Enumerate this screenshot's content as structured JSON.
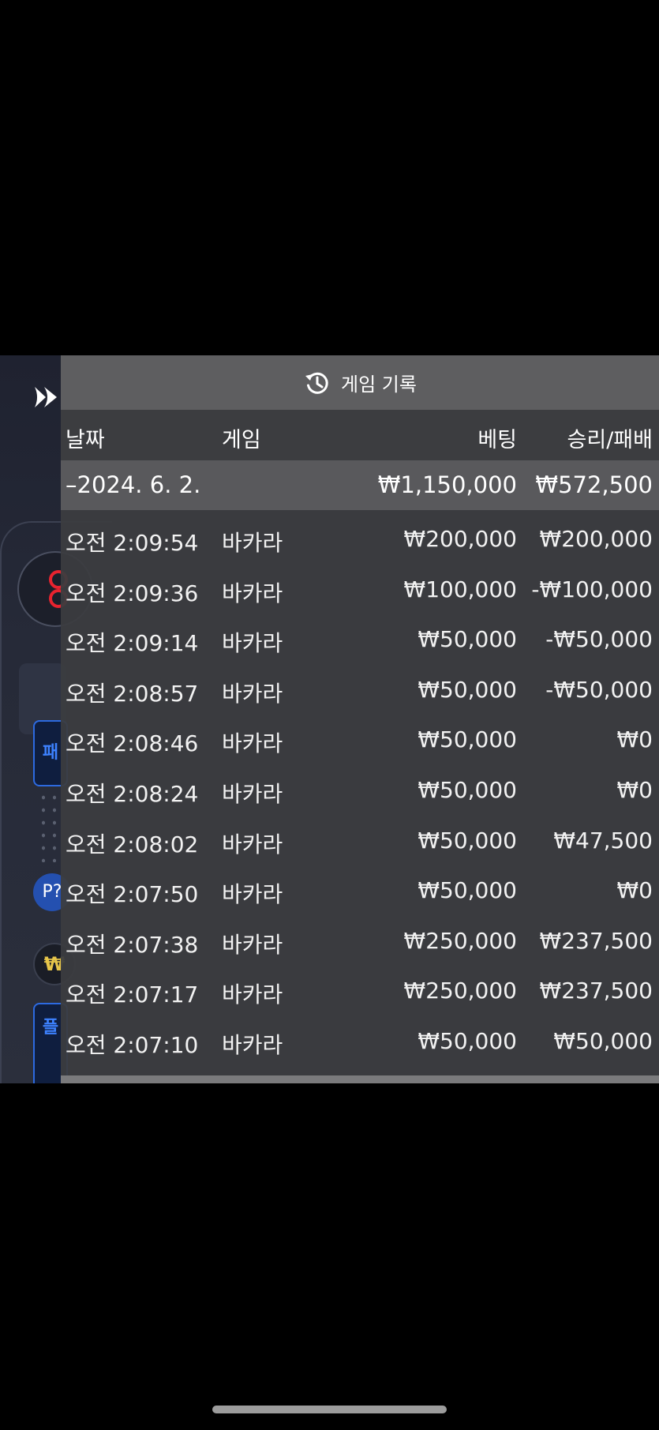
{
  "panel": {
    "title": "게임 기록",
    "title_icon": "history-icon"
  },
  "columns": {
    "date": "날짜",
    "game": "게임",
    "bet": "베팅",
    "win_loss": "승리/패배"
  },
  "summary": {
    "date": "–2024. 6. 2.",
    "bet": "₩1,150,000",
    "win_loss": "₩572,500"
  },
  "rows": [
    {
      "time": "오전 2:09:54",
      "game": "바카라",
      "bet": "₩200,000",
      "win_loss": "₩200,000"
    },
    {
      "time": "오전 2:09:36",
      "game": "바카라",
      "bet": "₩100,000",
      "win_loss": "-₩100,000"
    },
    {
      "time": "오전 2:09:14",
      "game": "바카라",
      "bet": "₩50,000",
      "win_loss": "-₩50,000"
    },
    {
      "time": "오전 2:08:57",
      "game": "바카라",
      "bet": "₩50,000",
      "win_loss": "-₩50,000"
    },
    {
      "time": "오전 2:08:46",
      "game": "바카라",
      "bet": "₩50,000",
      "win_loss": "₩0"
    },
    {
      "time": "오전 2:08:24",
      "game": "바카라",
      "bet": "₩50,000",
      "win_loss": "₩0"
    },
    {
      "time": "오전 2:08:02",
      "game": "바카라",
      "bet": "₩50,000",
      "win_loss": "₩47,500"
    },
    {
      "time": "오전 2:07:50",
      "game": "바카라",
      "bet": "₩50,000",
      "win_loss": "₩0"
    },
    {
      "time": "오전 2:07:38",
      "game": "바카라",
      "bet": "₩250,000",
      "win_loss": "₩237,500"
    },
    {
      "time": "오전 2:07:17",
      "game": "바카라",
      "bet": "₩250,000",
      "win_loss": "₩237,500"
    },
    {
      "time": "오전 2:07:10",
      "game": "바카라",
      "bet": "₩50,000",
      "win_loss": "₩50,000"
    }
  ],
  "background": {
    "p_badge": "P?",
    "won_badge": "₩",
    "blue_box_1": "패",
    "blue_box_2": "플"
  },
  "colors": {
    "panel_bg": "#3c3d40",
    "header_bg": "#5e5e60",
    "summary_bg": "#59595c",
    "accent_red": "#e8232f",
    "accent_blue": "#2d6ae0"
  }
}
